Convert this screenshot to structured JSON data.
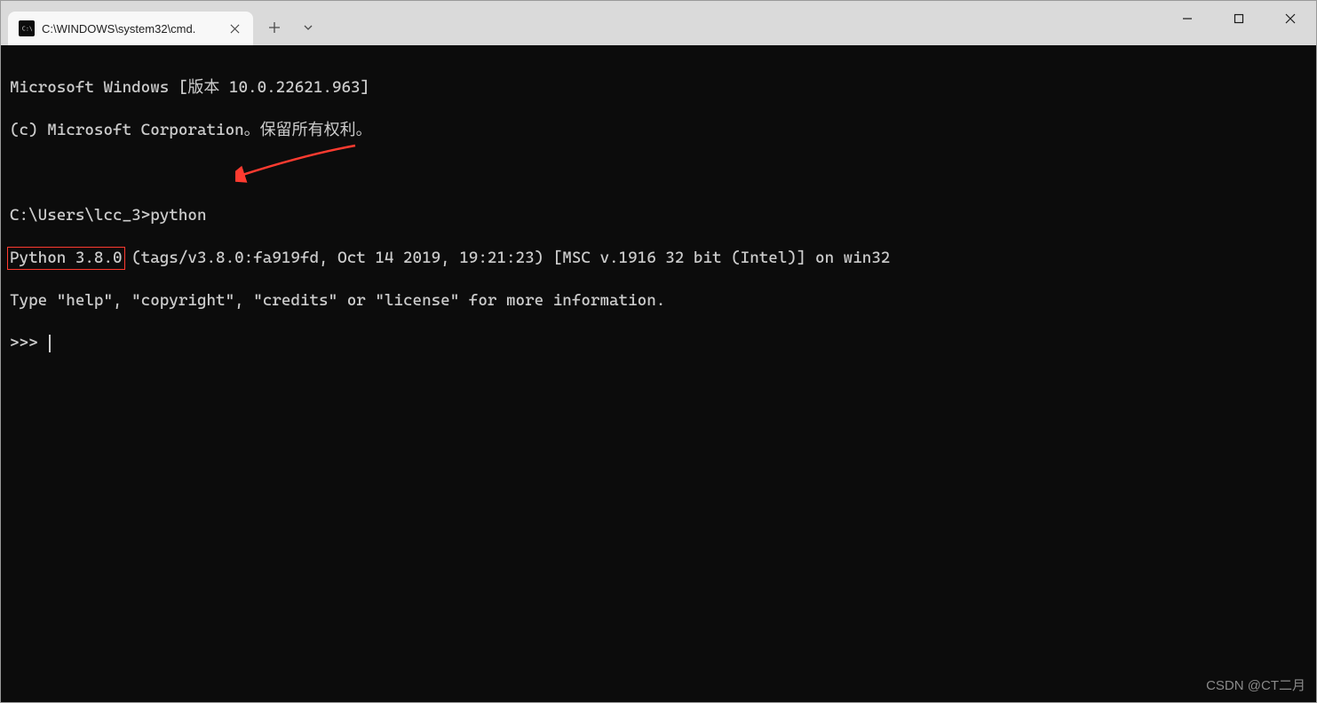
{
  "titlebar": {
    "tab": {
      "title": "C:\\WINDOWS\\system32\\cmd."
    }
  },
  "terminal": {
    "line1": "Microsoft Windows [版本 10.0.22621.963]",
    "line2": "(c) Microsoft Corporation。保留所有权利。",
    "prompt_line_prefix": "C:\\Users\\lcc_3>",
    "prompt_line_cmd": "python",
    "python_version_highlighted": "Python 3.8.0",
    "python_version_rest": " (tags/v3.8.0:fa919fd, Oct 14 2019, 19:21:23) [MSC v.1916 32 bit (Intel)] on win32",
    "python_help_line": "Type \"help\", \"copyright\", \"credits\" or \"license\" for more information.",
    "repl_prompt": ">>> "
  },
  "watermark": "CSDN @CT二月"
}
